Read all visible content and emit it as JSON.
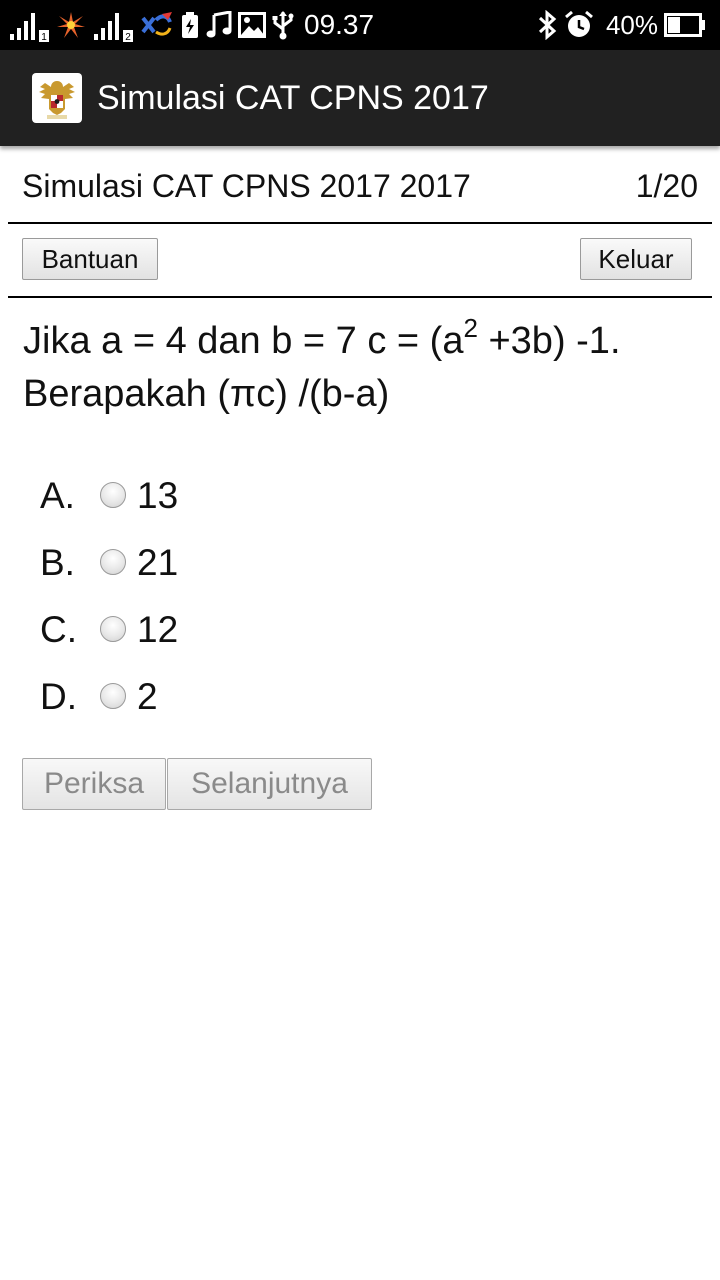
{
  "status_bar": {
    "sim1_label": "1",
    "sim2_label": "2",
    "time": "09.37",
    "battery": "40%",
    "icons": [
      "signal-icon",
      "network-icon",
      "signal-icon",
      "network-icon",
      "battery-saver-icon",
      "music-icon",
      "image-icon",
      "usb-icon",
      "bluetooth-icon",
      "alarm-icon",
      "battery-icon"
    ],
    "battery_level": 0.4
  },
  "app_bar": {
    "title": "Simulasi CAT CPNS 2017",
    "logo_icon": "garuda-emblem-icon"
  },
  "quiz": {
    "title": "Simulasi CAT CPNS 2017 2017",
    "progress": "1/20",
    "help_button": "Bantuan",
    "exit_button": "Keluar"
  },
  "question": {
    "text_part1": "Jika a = 4 dan b = 7 c = (a",
    "superscript": "2",
    "text_part2": " +3b) -1. Berapakah (πc) /(b-a)"
  },
  "options": [
    {
      "letter": "A.",
      "value": "13"
    },
    {
      "letter": "B.",
      "value": "21"
    },
    {
      "letter": "C.",
      "value": "12"
    },
    {
      "letter": "D.",
      "value": "2"
    }
  ],
  "actions": {
    "check_button": "Periksa",
    "next_button": "Selanjutnya"
  },
  "colors": {
    "status_bar_bg": "#000000",
    "app_bar_bg": "#212121",
    "content_bg": "#ffffff",
    "disabled_text": "#8a8a8a"
  }
}
